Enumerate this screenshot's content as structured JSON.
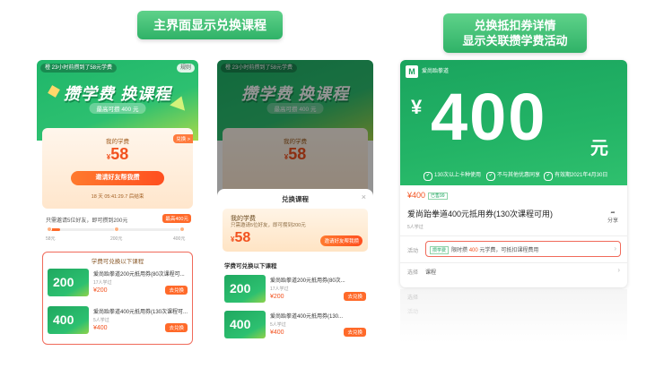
{
  "captions": {
    "left": "主界面显示兑换课程",
    "right_line1": "兑换抵扣券详情",
    "right_line2": "显示关联攒学费活动"
  },
  "screen1": {
    "notice": "橙 23小时前攒到了58元学费",
    "rules": "规则",
    "banner_title": "攒学费 换课程",
    "banner_sub": "最高可攒 400 元",
    "card_title": "我的学费",
    "card_value": "58",
    "card_currency": "¥",
    "card_tag": "兑换 >",
    "invite_button": "邀请好友帮我攒",
    "countdown": "18 天 05:41:29.7 后结束",
    "progress_text": "只需邀请5位好友，即可攒到200元",
    "progress_tag": "最高400元",
    "progress_fraction": 0.08,
    "progress_labels": [
      "58元",
      "200元",
      "400元"
    ],
    "coupons_header": "学费可兑换以下课程",
    "coupons": [
      {
        "thumb": "200",
        "name": "爱尚跆拳道200元抵用券(80次课程可...",
        "count": "17人学过",
        "price": "¥200",
        "action": "去兑换"
      },
      {
        "thumb": "400",
        "name": "爱尚跆拳道400元抵用券(130次课程可...",
        "count": "5人学过",
        "price": "¥400",
        "action": "去兑换"
      }
    ]
  },
  "screen2": {
    "notice": "橙 23小时前攒到了58元学费",
    "banner_title": "攒学费 换课程",
    "banner_sub": "最高可攒 400 元",
    "card_title": "我的学费",
    "card_value": "58",
    "sheet_title": "兑换课程",
    "close": "×",
    "my_title": "我的学费",
    "my_desc": "只需邀请5位好友，即可攒到200元",
    "my_value": "58",
    "my_button": "邀请好友帮我攒",
    "list_header": "学费可兑换以下课程",
    "coupons": [
      {
        "thumb": "200",
        "name": "爱尚跆拳道200元抵用券(80次...",
        "count": "17人学过",
        "price": "¥200",
        "action": "去兑换"
      },
      {
        "thumb": "400",
        "name": "爱尚跆拳道400元抵用券(130...",
        "count": "5人学过",
        "price": "¥400",
        "action": "去兑换"
      }
    ]
  },
  "screen3": {
    "brand": "爱尚跆拳道",
    "yen": "¥",
    "amount": "400",
    "unit": "元",
    "features": [
      "130次以上卡种使用",
      "不与其他优惠同享",
      "有效期2021年4月30日"
    ],
    "price": "¥400",
    "price_tag": "已售99",
    "title": "爱尚跆拳道400元抵用券(130次课程可用)",
    "sold": "5人学过",
    "share": "分享",
    "activity_label": "活动",
    "activity_tag": "攒学费",
    "activity_text_pre": "限时攒",
    "activity_amount": "400",
    "activity_text_post": "元学费，可抵扣课程费用",
    "select_label": "选择",
    "select_value": "课程"
  },
  "colors": {
    "brand_green": "#23b466",
    "accent_orange": "#ff6a2a",
    "highlight_red": "#f06a5a"
  }
}
